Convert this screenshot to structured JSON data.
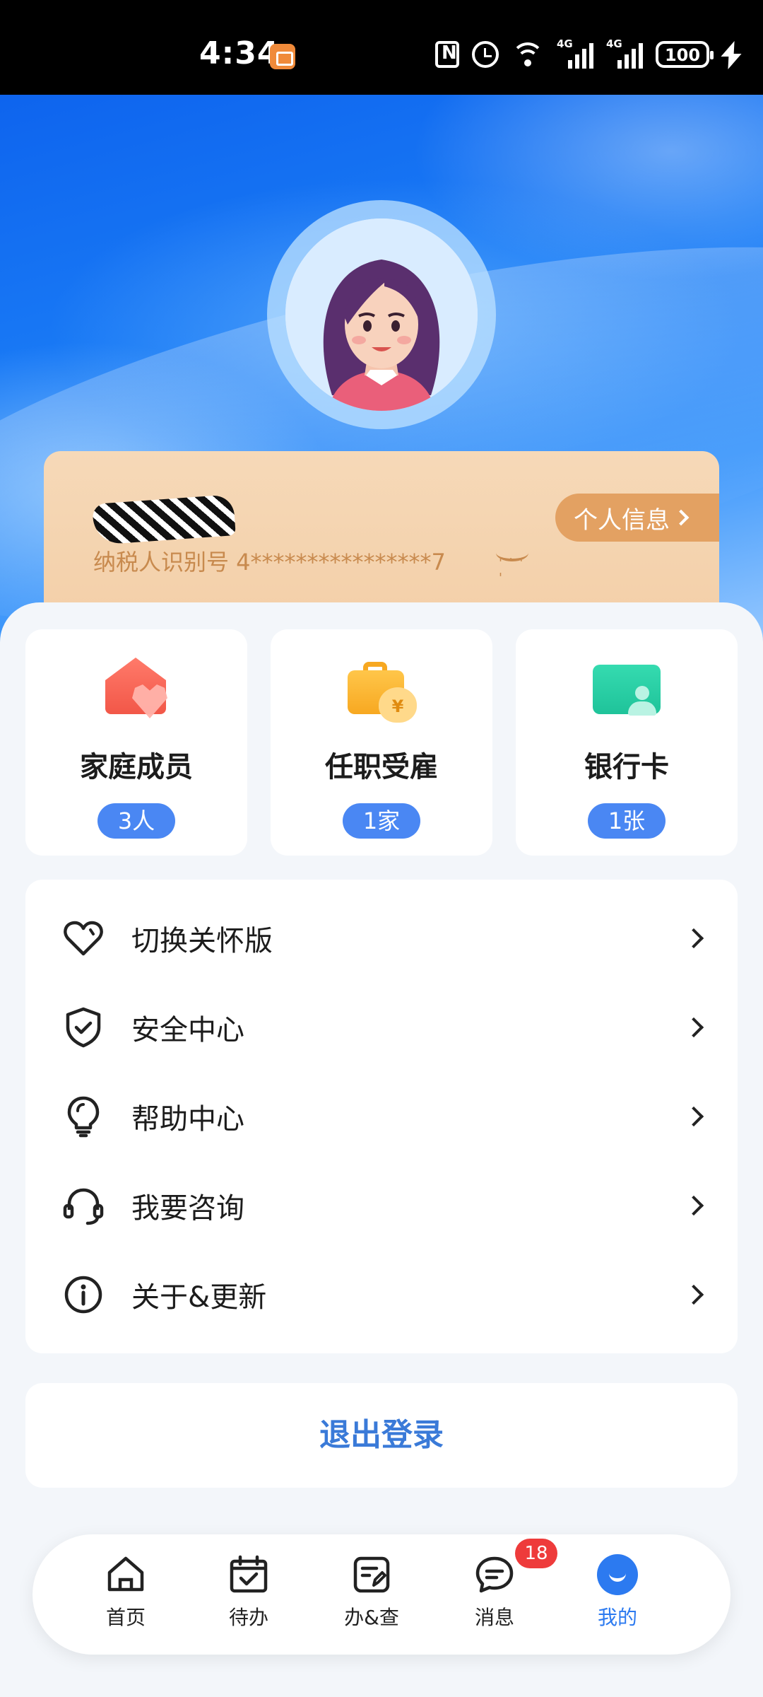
{
  "status_bar": {
    "time": "4:34",
    "battery": "100",
    "signal_1": "4G",
    "signal_2": "4G",
    "icons": [
      "app-notification-icon",
      "nfc-icon",
      "alarm-icon",
      "wifi-icon",
      "signal-icon",
      "signal-icon",
      "battery-icon",
      "charging-icon"
    ]
  },
  "profile": {
    "avatar": "female-avatar",
    "tax_id_label": "纳税人识别号 4****************7",
    "visibility_icon": "eye-closed-icon",
    "info_button": "个人信息"
  },
  "tiles": [
    {
      "title": "家庭成员",
      "badge": "3人",
      "icon": "family-home-icon",
      "color": "#f25748"
    },
    {
      "title": "任职受雇",
      "badge": "1家",
      "icon": "briefcase-money-icon",
      "color": "#f7a821"
    },
    {
      "title": "银行卡",
      "badge": "1张",
      "icon": "bank-card-icon",
      "color": "#1fc39a"
    }
  ],
  "menu": [
    {
      "label": "切换关怀版",
      "icon": "heart-icon"
    },
    {
      "label": "安全中心",
      "icon": "shield-check-icon"
    },
    {
      "label": "帮助中心",
      "icon": "lightbulb-icon"
    },
    {
      "label": "我要咨询",
      "icon": "headset-icon"
    },
    {
      "label": "关于&更新",
      "icon": "info-icon"
    }
  ],
  "logout_label": "退出登录",
  "tabbar": [
    {
      "label": "首页",
      "icon": "home-icon"
    },
    {
      "label": "待办",
      "icon": "calendar-check-icon"
    },
    {
      "label": "办&查",
      "icon": "document-edit-icon"
    },
    {
      "label": "消息",
      "icon": "chat-icon",
      "badge": "18"
    },
    {
      "label": "我的",
      "icon": "profile-smile-icon",
      "active": true
    }
  ],
  "colors": {
    "accent": "#2c7af0",
    "badge_blue": "#4a87f3",
    "notification_red": "#ee3b3b",
    "card_tan": "#f3cfa8",
    "card_text": "#c88a4e"
  }
}
